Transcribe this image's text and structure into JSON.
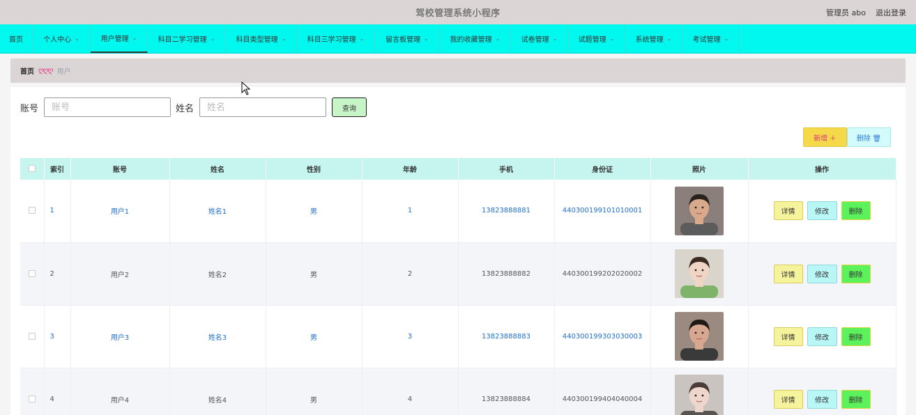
{
  "header": {
    "title": "驾校管理系统小程序",
    "user_label": "管理员 abo",
    "logout_label": "退出登录"
  },
  "nav": {
    "items": [
      {
        "label": "首页",
        "has_menu": false,
        "active": false
      },
      {
        "label": "个人中心",
        "has_menu": true,
        "active": false
      },
      {
        "label": "用户管理",
        "has_menu": true,
        "active": true
      },
      {
        "label": "科目二学习管理",
        "has_menu": true,
        "active": false
      },
      {
        "label": "科目类型管理",
        "has_menu": true,
        "active": false
      },
      {
        "label": "科目三学习管理",
        "has_menu": true,
        "active": false
      },
      {
        "label": "留言板管理",
        "has_menu": true,
        "active": false
      },
      {
        "label": "我的收藏管理",
        "has_menu": true,
        "active": false
      },
      {
        "label": "试卷管理",
        "has_menu": true,
        "active": false
      },
      {
        "label": "试题管理",
        "has_menu": true,
        "active": false
      },
      {
        "label": "系统管理",
        "has_menu": true,
        "active": false
      },
      {
        "label": "考试管理",
        "has_menu": true,
        "active": false
      }
    ]
  },
  "breadcrumb": {
    "home": "首页",
    "separator": "ღღღ",
    "current": "用户"
  },
  "search": {
    "account_label": "账号",
    "account_placeholder": "账号",
    "account_value": "",
    "name_label": "姓名",
    "name_placeholder": "姓名",
    "name_value": "",
    "button_label": "查询"
  },
  "actions": {
    "add_label": "新增 ＋",
    "delete_label": "删除 🗑"
  },
  "table": {
    "columns": [
      "",
      "索引",
      "账号",
      "姓名",
      "性别",
      "年龄",
      "手机",
      "身份证",
      "照片",
      "操作"
    ],
    "rows": [
      {
        "index": "1",
        "account": "用户1",
        "name": "姓名1",
        "gender": "男",
        "age": "1",
        "phone": "13823888881",
        "id_card": "440300199101010001",
        "photo": "photo-1"
      },
      {
        "index": "2",
        "account": "用户2",
        "name": "姓名2",
        "gender": "男",
        "age": "2",
        "phone": "13823888882",
        "id_card": "440300199202020002",
        "photo": "photo-2"
      },
      {
        "index": "3",
        "account": "用户3",
        "name": "姓名3",
        "gender": "男",
        "age": "3",
        "phone": "13823888883",
        "id_card": "440300199303030003",
        "photo": "photo-3"
      },
      {
        "index": "4",
        "account": "用户4",
        "name": "姓名4",
        "gender": "男",
        "age": "4",
        "phone": "13823888884",
        "id_card": "440300199404040004",
        "photo": "photo-4"
      }
    ],
    "op_labels": {
      "detail": "详情",
      "edit": "修改",
      "delete": "删除"
    }
  },
  "colors": {
    "nav_bg": "#00f8ef",
    "header_bg": "#dcd5d5",
    "table_header_bg": "#c6f4ef",
    "link_blue": "#1f6fc9"
  }
}
